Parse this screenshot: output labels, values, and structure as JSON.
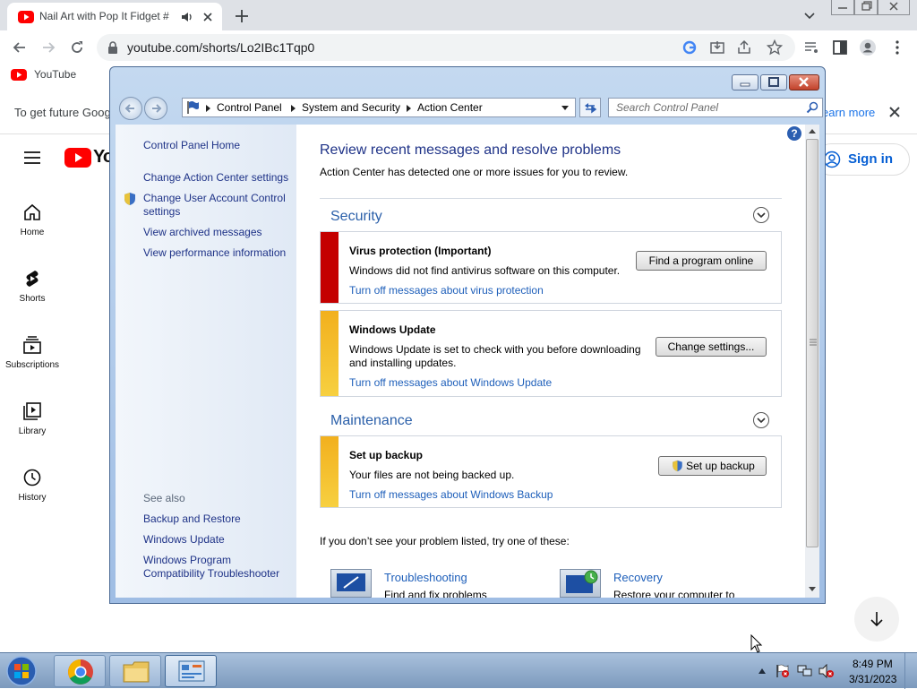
{
  "chrome": {
    "tab_title": "Nail Art with Pop It Fidget #",
    "url": "youtube.com/shorts/Lo2IBc1Tqp0",
    "bookmark_youtube": "YouTube"
  },
  "youtube": {
    "banner_text": "To get future Goog",
    "banner_learn": "earn more",
    "logo_text": "Yo",
    "sign_in": "Sign in",
    "nav": {
      "home": "Home",
      "shorts": "Shorts",
      "subscriptions": "Subscriptions",
      "library": "Library",
      "history": "History"
    }
  },
  "control_panel": {
    "breadcrumbs": [
      "Control Panel",
      "System and Security",
      "Action Center"
    ],
    "search_placeholder": "Search Control Panel",
    "sidebar": {
      "home": "Control Panel Home",
      "change_ac": "Change Action Center settings",
      "uac": "Change User Account Control settings",
      "archived": "View archived messages",
      "perf": "View performance information",
      "see_also": "See also",
      "backup": "Backup and Restore",
      "update": "Windows Update",
      "compat": "Windows Program Compatibility Troubleshooter"
    },
    "heading": "Review recent messages and resolve problems",
    "subheading": "Action Center has detected one or more issues for you to review.",
    "security_title": "Security",
    "maintenance_title": "Maintenance",
    "virus": {
      "title": "Virus protection  (Important)",
      "desc": "Windows did not find antivirus software on this computer.",
      "link": "Turn off messages about virus protection",
      "button": "Find a program online",
      "color": "#c40000"
    },
    "update_msg": {
      "title": "Windows Update",
      "desc": "Windows Update is set to check with you before downloading and installing updates.",
      "link": "Turn off messages about Windows Update",
      "button": "Change settings...",
      "color": "#f2b01e"
    },
    "backup_msg": {
      "title": "Set up backup",
      "desc": "Your files are not being backed up.",
      "link": "Turn off messages about Windows Backup",
      "button": "Set up backup",
      "color": "#f2b01e"
    },
    "more_text": "If you don’t see your problem listed, try one of these:",
    "troubleshooting": {
      "title": "Troubleshooting",
      "desc": "Find and fix problems"
    },
    "recovery": {
      "title": "Recovery",
      "desc": "Restore your computer to"
    }
  },
  "taskbar": {
    "time": "8:49 PM",
    "date": "3/31/2023"
  }
}
